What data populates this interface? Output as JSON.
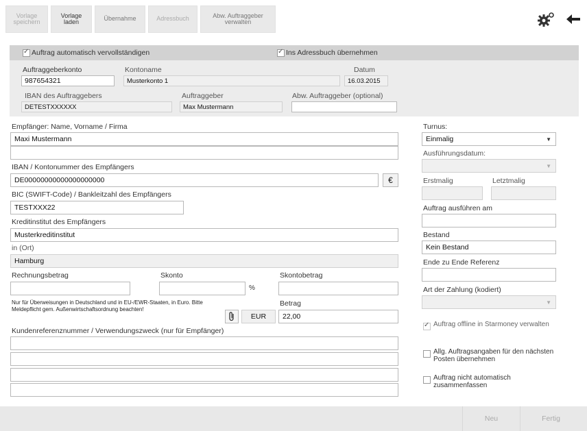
{
  "toolbar": {
    "buttons": [
      {
        "label": "Vorlage\nspeichern",
        "state": "disabled"
      },
      {
        "label": "Vorlage\nladen",
        "state": "active"
      },
      {
        "label": "Übernahme",
        "state": "normal"
      },
      {
        "label": "Adressbuch",
        "state": "disabled"
      },
      {
        "label": "Abw. Auftraggeber\nverwalten",
        "state": "normal"
      }
    ],
    "settings_icon": "gear-icon",
    "back_icon": "arrow-left-icon"
  },
  "header_panel": {
    "auto_complete_label": "Auftrag automatisch vervollständigen",
    "auto_complete_checked": true,
    "to_addressbook_label": "Ins Adressbuch übernehmen",
    "to_addressbook_checked": true,
    "account_label": "Auftraggeberkonto",
    "account_value": "987654321",
    "account_name_label": "Kontoname",
    "account_name_value": "Musterkonto 1",
    "date_label": "Datum",
    "date_value": "16.03.2015",
    "iban_label": "IBAN des Auftraggebers",
    "iban_value": "DETESTXXXXXX",
    "orderer_label": "Auftraggeber",
    "orderer_value": "Max Mustermann",
    "alt_orderer_label": "Abw. Auftraggeber (optional)",
    "alt_orderer_value": ""
  },
  "form": {
    "recipient_label": "Empfänger: Name, Vorname / Firma",
    "recipient_value": "Maxi Mustermann",
    "recipient_value2": "",
    "iban_label": "IBAN / Kontonummer des Empfängers",
    "iban_value": "DE00000000000000000000",
    "euro_symbol": "€",
    "bic_label": "BIC (SWIFT-Code) / Bankleitzahl des Empfängers",
    "bic_value": "TESTXXX22",
    "bank_label": "Kreditinstitut des Empfängers",
    "bank_value": "Musterkreditinstitut",
    "city_label": "in (Ort)",
    "city_value": "Hamburg",
    "invoice_label": "Rechnungsbetrag",
    "invoice_value": "",
    "discount_label": "Skonto",
    "discount_value": "",
    "percent_symbol": "%",
    "discount_amount_label": "Skontobetrag",
    "discount_amount_value": "",
    "notice_text": "Nur für Überweisungen in Deutschland und in EU-/EWR-Staaten, in Euro. Bitte Meldepflicht gem. Außenwirtschaftsordnung beachten!",
    "currency_value": "EUR",
    "amount_label": "Betrag",
    "amount_value": "22,00",
    "reference_label": "Kundenreferenznummer / Verwendungszweck (nur für Empfänger)",
    "reference_lines": [
      "",
      "",
      "",
      ""
    ]
  },
  "side": {
    "turnus_label": "Turnus:",
    "turnus_value": "Einmalig",
    "exec_date_label": "Ausführungsdatum:",
    "exec_date_value": "",
    "first_label": "Erstmalig",
    "last_label": "Letztmalig",
    "exec_on_label": "Auftrag ausführen am",
    "exec_on_value": "",
    "stock_label": "Bestand",
    "stock_value": "Kein Bestand",
    "e2e_label": "Ende zu Ende Referenz",
    "e2e_value": "",
    "payment_type_label": "Art der Zahlung (kodiert)",
    "payment_type_value": "",
    "offline_label": "Auftrag offline in Starmoney verwalten",
    "offline_checked": true,
    "general_label": "Allg. Auftragsangaben für den nächsten Posten übernehmen",
    "general_checked": false,
    "no_merge_label": "Auftrag nicht automatisch zusammenfassen",
    "no_merge_checked": false
  },
  "footer": {
    "new_label": "Neu",
    "done_label": "Fertig"
  }
}
